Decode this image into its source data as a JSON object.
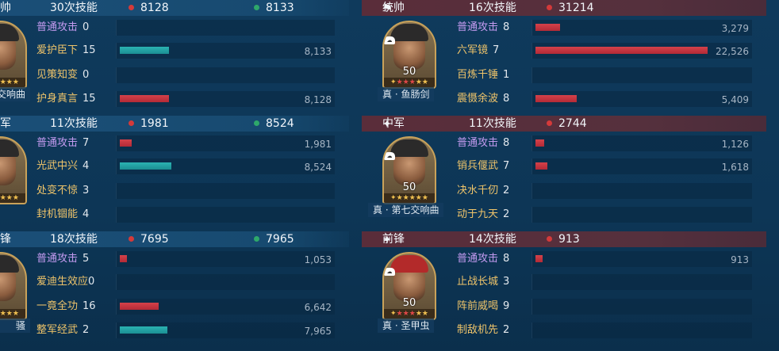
{
  "left_teams": [
    {
      "role": "帅",
      "skill_count": "30次技能",
      "damage": "8128",
      "heal": "8133",
      "hero_name": "交响曲",
      "skills": [
        {
          "name": "普通攻击",
          "count": "0",
          "basic": true,
          "value": "",
          "bar_color": "",
          "bar_frac": 0
        },
        {
          "name": "爱护臣下",
          "count": "15",
          "basic": false,
          "value": "8,133",
          "bar_color": "teal",
          "bar_frac": 0.29
        },
        {
          "name": "见策知变",
          "count": "0",
          "basic": false,
          "value": "",
          "bar_color": "",
          "bar_frac": 0
        },
        {
          "name": "护身真言",
          "count": "15",
          "basic": false,
          "value": "8,128",
          "bar_color": "red",
          "bar_frac": 0.29
        }
      ]
    },
    {
      "role": "军",
      "skill_count": "11次技能",
      "damage": "1981",
      "heal": "8524",
      "hero_name": "",
      "skills": [
        {
          "name": "普通攻击",
          "count": "7",
          "basic": true,
          "value": "1,981",
          "bar_color": "red",
          "bar_frac": 0.07
        },
        {
          "name": "光武中兴",
          "count": "4",
          "basic": false,
          "value": "8,524",
          "bar_color": "teal",
          "bar_frac": 0.3
        },
        {
          "name": "处变不惊",
          "count": "3",
          "basic": false,
          "value": "",
          "bar_color": "",
          "bar_frac": 0
        },
        {
          "name": "封机锢能",
          "count": "4",
          "basic": false,
          "value": "",
          "bar_color": "",
          "bar_frac": 0
        }
      ]
    },
    {
      "role": "锋",
      "skill_count": "18次技能",
      "damage": "7695",
      "heal": "7965",
      "hero_name": "骚",
      "skills": [
        {
          "name": "普通攻击",
          "count": "5",
          "basic": true,
          "value": "1,053",
          "bar_color": "red",
          "bar_frac": 0.04
        },
        {
          "name": "爱迪生效应",
          "count": "0",
          "basic": false,
          "value": "",
          "bar_color": "",
          "bar_frac": 0
        },
        {
          "name": "一竟全功",
          "count": "16",
          "basic": false,
          "value": "6,642",
          "bar_color": "red",
          "bar_frac": 0.23
        },
        {
          "name": "整军经武",
          "count": "2",
          "basic": false,
          "value": "7,965",
          "bar_color": "teal",
          "bar_frac": 0.28
        }
      ]
    }
  ],
  "right_teams": [
    {
      "role": "统帅",
      "role_icon": "commander-flag-icon",
      "skill_count": "16次技能",
      "damage": "31214",
      "hero_level": "50",
      "hero_name": "真 · 鱼肠剑",
      "skills": [
        {
          "name": "普通攻击",
          "count": "8",
          "basic": true,
          "value": "3,279",
          "bar_color": "red",
          "bar_frac": 0.145
        },
        {
          "name": "六军镜",
          "count": "7",
          "basic": false,
          "value": "22,526",
          "bar_color": "red",
          "bar_frac": 1.0
        },
        {
          "name": "百炼千锤",
          "count": "1",
          "basic": false,
          "value": "",
          "bar_color": "",
          "bar_frac": 0
        },
        {
          "name": "震慑余波",
          "count": "8",
          "basic": false,
          "value": "5,409",
          "bar_color": "red",
          "bar_frac": 0.24
        }
      ]
    },
    {
      "role": "中军",
      "role_icon": "sparkle-icon",
      "skill_count": "11次技能",
      "damage": "2744",
      "hero_level": "50",
      "hero_name": "真 · 第七交响曲",
      "skills": [
        {
          "name": "普通攻击",
          "count": "8",
          "basic": true,
          "value": "1,126",
          "bar_color": "red",
          "bar_frac": 0.05
        },
        {
          "name": "销兵偃武",
          "count": "7",
          "basic": false,
          "value": "1,618",
          "bar_color": "red",
          "bar_frac": 0.07
        },
        {
          "name": "决水千仞",
          "count": "2",
          "basic": false,
          "value": "",
          "bar_color": "",
          "bar_frac": 0
        },
        {
          "name": "动于九天",
          "count": "2",
          "basic": false,
          "value": "",
          "bar_color": "",
          "bar_frac": 0
        }
      ]
    },
    {
      "role": "前锋",
      "role_icon": "sparkle-icon",
      "skill_count": "14次技能",
      "damage": "913",
      "hero_level": "50",
      "hero_name": "真 · 圣甲虫",
      "skills": [
        {
          "name": "普通攻击",
          "count": "8",
          "basic": true,
          "value": "913",
          "bar_color": "red",
          "bar_frac": 0.04
        },
        {
          "name": "止战长城",
          "count": "3",
          "basic": false,
          "value": "",
          "bar_color": "",
          "bar_frac": 0
        },
        {
          "name": "阵前威喝",
          "count": "9",
          "basic": false,
          "value": "",
          "bar_color": "",
          "bar_frac": 0
        },
        {
          "name": "制敌机先",
          "count": "2",
          "basic": false,
          "value": "",
          "bar_color": "",
          "bar_frac": 0
        }
      ]
    }
  ],
  "colors": {
    "damage_dot": "#d43a3a",
    "heal_dot": "#2ea86a",
    "damage_bar": "#c13440",
    "heal_bar": "#22a3a4",
    "basic_attack_text": "#c49bf0",
    "skill_text": "#efc46a"
  },
  "icons": {
    "damage": "red-dot-icon",
    "heal": "green-dot-icon",
    "stars": "star-rating-icon"
  }
}
